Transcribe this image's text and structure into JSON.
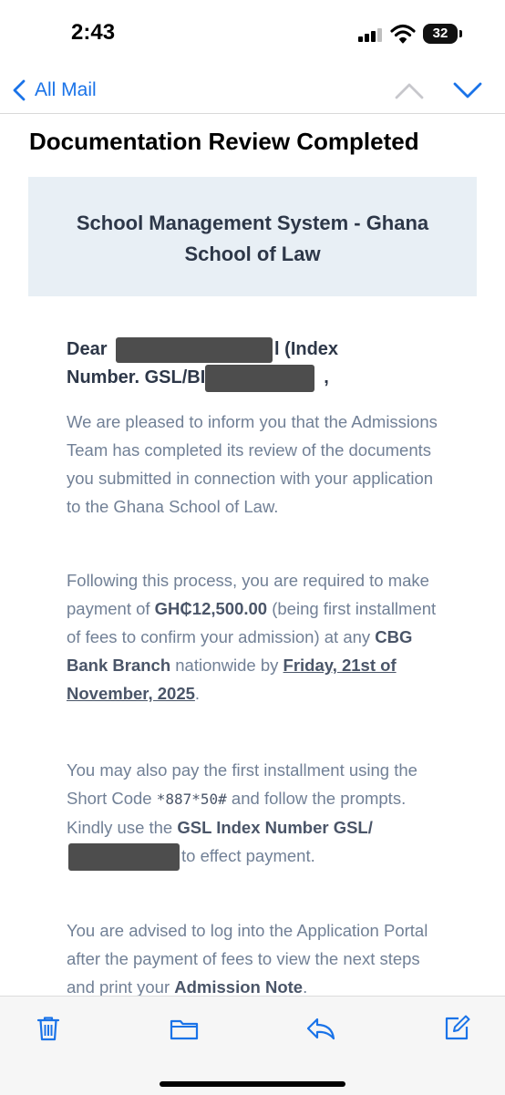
{
  "status_bar": {
    "time": "2:43",
    "battery": "32"
  },
  "nav": {
    "back_label": "All Mail"
  },
  "email": {
    "subject": "Documentation Review Completed",
    "org_line1": "School Management System - Ghana",
    "org_line2": "School of Law",
    "greeting_dear": "Dear",
    "greeting_l": "l (Index",
    "greeting_index_prefix": "Number. GSL/BI",
    "greeting_comma": ",",
    "p1": "We are pleased to inform you that the Admissions Team has completed its review of the documents you submitted in connection with your application to the Ghana School of Law.",
    "p2_a": "Following this process, you are required to make payment of ",
    "p2_amount": "GH₵12,500.00",
    "p2_b": " (being first installment of fees to confirm your admission) at any ",
    "p2_bank": "CBG Bank Branch",
    "p2_c": " nationwide by ",
    "p2_date": "Friday, 21st of November, 2025",
    "p2_d": ".",
    "p3_a": "You may also pay the first installment using the Short Code ",
    "p3_code": "*887*50#",
    "p3_b": " and follow the prompts. Kindly use the ",
    "p3_index": "GSL Index Number GSL/",
    "p3_c": "to effect payment.",
    "p4_a": "You are advised to log into the Application Portal after the payment of fees to view the next steps and print your ",
    "p4_note": "Admission Note",
    "p4_b": "."
  },
  "colors": {
    "accent": "#1a73e8",
    "header_bg": "#e8eff5",
    "body_text": "#718096"
  }
}
